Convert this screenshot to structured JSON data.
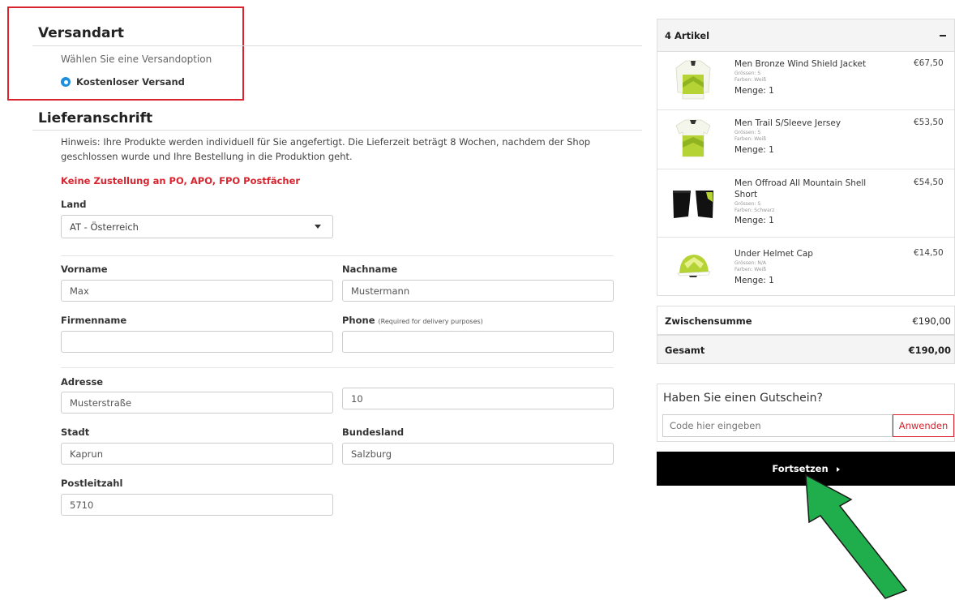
{
  "shipping": {
    "title": "Versandart",
    "prompt": "Wählen Sie eine Versandoption",
    "option": "Kostenloser Versand"
  },
  "address": {
    "title": "Lieferanschrift",
    "notice": "Hinweis: Ihre Produkte werden individuell für Sie angefertigt. Die Lieferzeit beträgt 8 Wochen, nachdem der Shop geschlossen wurde und Ihre Bestellung in die Produktion geht.",
    "warning": "Keine Zustellung an PO, APO, FPO Postfächer",
    "country_label": "Land",
    "country_value": "AT - Österreich",
    "firstname_label": "Vorname",
    "firstname_value": "Max",
    "lastname_label": "Nachname",
    "lastname_value": "Mustermann",
    "company_label": "Firmenname",
    "company_value": "",
    "phone_label": "Phone",
    "phone_note": "(Required for delivery purposes)",
    "phone_value": "",
    "street_label": "Adresse",
    "street_value": "Musterstraße",
    "house_number_value": "10",
    "city_label": "Stadt",
    "city_value": "Kaprun",
    "state_label": "Bundesland",
    "state_value": "Salzburg",
    "zip_label": "Postleitzahl",
    "zip_value": "5710"
  },
  "cart": {
    "count_label": "4 Artikel",
    "items": [
      {
        "name": "Men Bronze Wind Shield Jacket",
        "size": "Grössen: S",
        "color": "Farben: Weiß",
        "qty": "Menge: 1",
        "price": "€67,50"
      },
      {
        "name": "Men Trail S/Sleeve Jersey",
        "size": "Grössen: S",
        "color": "Farben: Weiß",
        "qty": "Menge: 1",
        "price": "€53,50"
      },
      {
        "name": "Men Offroad All Mountain Shell Short",
        "size": "Grössen: S",
        "color": "Farben: Schwarz",
        "qty": "Menge: 1",
        "price": "€54,50"
      },
      {
        "name": "Under Helmet Cap",
        "size": "Grössen: N/A",
        "color": "Farben: Weiß",
        "qty": "Menge: 1",
        "price": "€14,50"
      }
    ],
    "subtotal_label": "Zwischensumme",
    "subtotal_value": "€190,00",
    "total_label": "Gesamt",
    "total_value": "€190,00"
  },
  "coupon": {
    "title": "Haben Sie einen Gutschein?",
    "placeholder": "Code hier eingeben",
    "apply_label": "Anwenden"
  },
  "continue_label": "Fortsetzen",
  "colors": {
    "highlight_red": "#d9232e",
    "radio_blue": "#1d8fde",
    "arrow_green": "#1fae4b",
    "product_lime": "#b5d334"
  },
  "icons": {
    "radio": "radio-selected-icon",
    "dropdown": "chevron-down-icon",
    "continue": "caret-right-icon",
    "collapse": "minus-icon",
    "annotation": "green-arrow-icon"
  }
}
